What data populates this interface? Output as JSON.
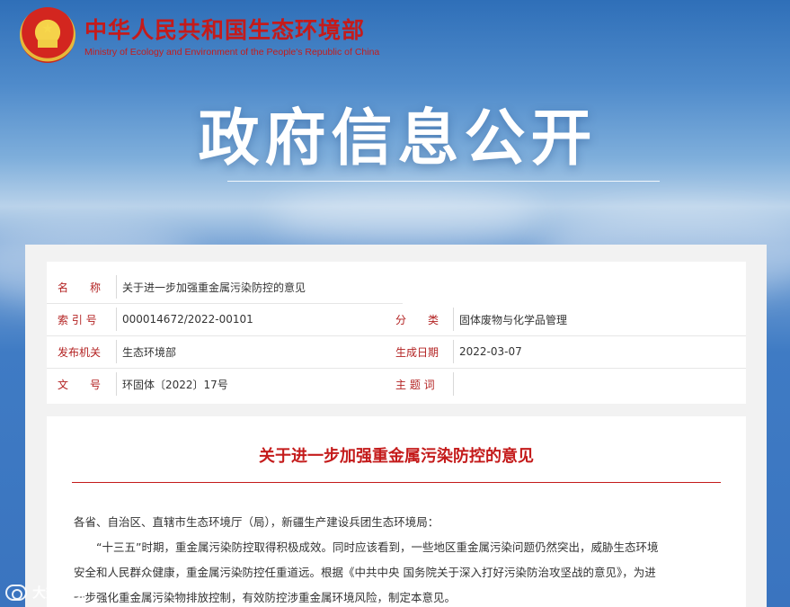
{
  "site": {
    "name_cn": "中华人民共和国生态环境部",
    "name_en": "Ministry of Ecology and Environment of the People's Republic of China"
  },
  "hero": {
    "title": "政府信息公开"
  },
  "info": {
    "name_label": "名　　称",
    "name_value": "关于进一步加强重金属污染防控的意见",
    "index_label": "索 引 号",
    "index_value": "000014672/2022-00101",
    "category_label": "分　　类",
    "category_value": "固体废物与化学品管理",
    "issuer_label": "发布机关",
    "issuer_value": "生态环境部",
    "date_label": "生成日期",
    "date_value": "2022-03-07",
    "docno_label": "文　　号",
    "docno_value": "环固体〔2022〕17号",
    "keywords_label": "主 题 词",
    "keywords_value": ""
  },
  "document": {
    "title": "关于进一步加强重金属污染防控的意见",
    "salutation": "各省、自治区、直辖市生态环境厅（局），新疆生产建设兵团生态环境局：",
    "p1_l1": "“十三五”时期，重金属污染防控取得积极成效。同时应该看到，一些地区重金属污染问题仍然突出，威胁生态环境",
    "p1_l2": "安全和人民群众健康，重金属污染防控任重道远。根据《中共中央 国务院关于深入打好污染防治攻坚战的意见》，为进",
    "p1_l3": "一步强化重金属污染物排放控制，有效防控涉重金属环境风险，制定本意见。"
  },
  "watermark": {
    "text": "大数跨境"
  },
  "colors": {
    "accent_red": "#c41b1b",
    "sky_blue": "#3a74bf"
  }
}
